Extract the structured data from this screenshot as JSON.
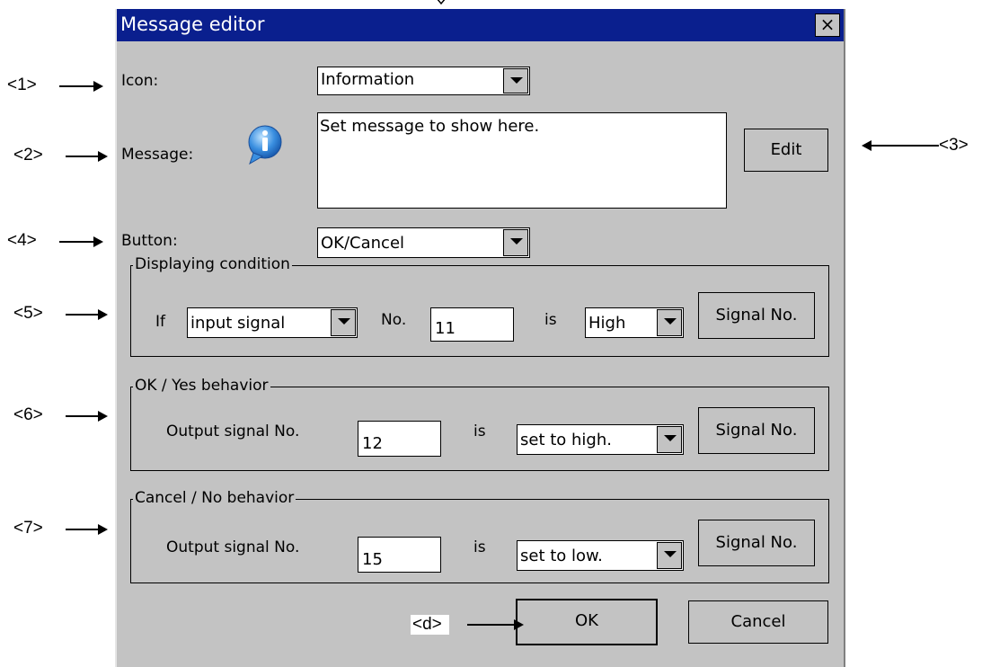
{
  "dialog": {
    "title": "Message editor",
    "close_glyph": "×",
    "icon_label": "Icon:",
    "icon_value": "Information",
    "message_label": "Message:",
    "message_value": "Set message to show here.",
    "message_icon": "info-icon",
    "edit_label": "Edit",
    "button_label": "Button:",
    "button_value": "OK/Cancel",
    "display_group": {
      "title": "Displaying condition",
      "if_label": "If",
      "signal_type": "input signal",
      "no_label": "No.",
      "no_value": "11",
      "is_label": "is",
      "state_value": "High",
      "signal_button": "Signal No."
    },
    "ok_group": {
      "title": "OK / Yes behavior",
      "output_label": "Output signal No.",
      "output_value": "12",
      "is_label": "is",
      "action_value": "set to high.",
      "signal_button": "Signal No."
    },
    "cancel_group": {
      "title": "Cancel / No behavior",
      "output_label": "Output signal No.",
      "output_value": "15",
      "is_label": "is",
      "action_value": "set to low.",
      "signal_button": "Signal No."
    },
    "ok_button": "OK",
    "cancel_button": "Cancel"
  },
  "callouts": {
    "c1": "<1>",
    "c2": "<2>",
    "c3": "<3>",
    "c4": "<4>",
    "c5": "<5>",
    "c6": "<6>",
    "c7": "<7>",
    "cd": "<d>"
  },
  "colors": {
    "titlebar": "#0a1f8e",
    "dialog_bg": "#c3c3c3",
    "info_icon": "#2f7fd6"
  }
}
